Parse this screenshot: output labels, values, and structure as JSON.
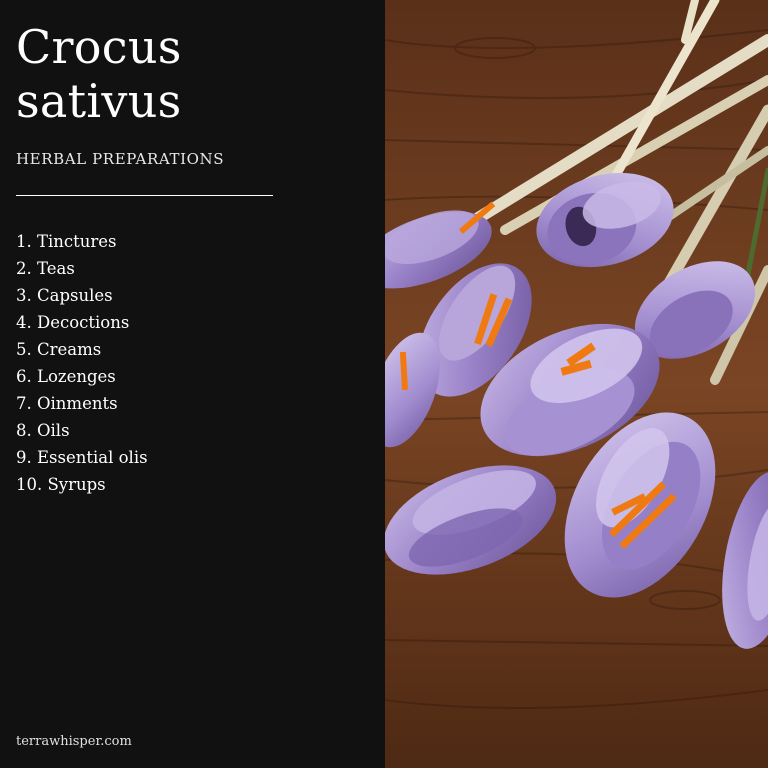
{
  "title_line1": "Crocus",
  "title_line2": "sativus",
  "subtitle": "HERBAL PREPARATIONS",
  "items": [
    "1. Tinctures",
    "2. Teas",
    "3. Capsules",
    "4. Decoctions",
    "5. Creams",
    "6. Lozenges",
    "7. Oinments",
    "8. Oils",
    "9. Essential olis",
    "10. Syrups"
  ],
  "website": "terrawhisper.com",
  "colors": {
    "panel": "#111111",
    "text": "#ffffff",
    "petal": "#9b86c6",
    "stigma": "#f07a12",
    "wood": "#6b3a1f"
  }
}
